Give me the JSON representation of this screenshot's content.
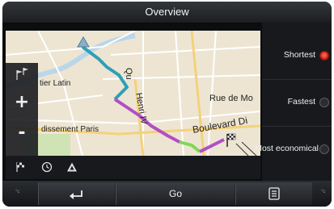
{
  "header": {
    "title": "Overview"
  },
  "map": {
    "labels": {
      "quartier": "tier Latin",
      "quai": "Qu",
      "henri": "Henri IV",
      "rue_de_mo": "Rue de Mo",
      "arrondissement": "dissement Paris",
      "boulevard": "Boulevard Di"
    }
  },
  "zoom": {
    "in_label": "+",
    "out_label": "-"
  },
  "toolbar": {
    "icons": [
      "finish-flag-icon",
      "clock-icon",
      "warning-triangle-icon"
    ]
  },
  "route_options": [
    {
      "label": "Shortest",
      "selected": true
    },
    {
      "label": "Fastest",
      "selected": false
    },
    {
      "label": "Most economical",
      "selected": false
    }
  ],
  "bottom_bar": {
    "temp_left": "°c",
    "temp_right": "°c",
    "back_icon": "back-arrow-icon",
    "go_label": "Go",
    "menu_icon": "menu-list-icon"
  },
  "colors": {
    "route_blue": "#2f9fb8",
    "route_green": "#7ed957",
    "route_purple": "#b14fc5",
    "map_background": "#ede5d2",
    "selected_radio": "#e0261a"
  }
}
